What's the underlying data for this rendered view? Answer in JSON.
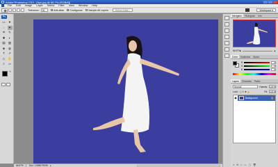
{
  "window": {
    "title": "Adobe Photoshop CS3 - [Ayu.jpg @ 66.7% (RGB/8)]",
    "controls": [
      "–",
      "□",
      "✕"
    ]
  },
  "menu": [
    "File",
    "Edit",
    "Image",
    "Layer",
    "Select",
    "Filter",
    "View",
    "Window",
    "Help"
  ],
  "options": {
    "tolerance_label": "Tolerance:",
    "tolerance_value": "30",
    "anti_alias": "Anti-alias",
    "contiguous": "Contiguous",
    "sample_all": "Sample All Layers",
    "refine": "Refine Edge...",
    "workspace": "Workspace ▾"
  },
  "toolbox": {
    "logo": "Ps",
    "tools": [
      "▭",
      "➤",
      "◌",
      "✦",
      "⌗",
      "✎",
      "✚",
      "◐",
      "▤",
      "▥",
      "◈",
      "◍",
      "T",
      "➚",
      "◇",
      "✋",
      "⌕",
      "▱"
    ]
  },
  "status": {
    "zoom": "66.67%",
    "doc": "Doc: 1.50M/799.9K",
    "arrow": "▸"
  },
  "panels": {
    "navigator_tabs": [
      "Navigator",
      "Histogram",
      "Info"
    ],
    "nav_zoom": "66.67%",
    "color_tabs": [
      "Color",
      "Swatches",
      "Styles"
    ],
    "color_channels": [
      {
        "label": "R",
        "value": "0"
      },
      {
        "label": "G",
        "value": "0"
      },
      {
        "label": "B",
        "value": "0"
      }
    ],
    "layers_tabs": [
      "Layers",
      "Channels",
      "Paths"
    ],
    "blend_mode": "Normal",
    "opacity_label": "Opacity:",
    "opacity": "100%",
    "lock_label": "Lock:",
    "fill_label": "Fill:",
    "fill": "100%",
    "layer_name": "Background",
    "footer_icons": [
      "∞",
      "fx",
      "◐",
      "▭",
      "▢",
      "🗑"
    ]
  },
  "colors": {
    "canvas_bg": "#3b3e9f",
    "selection_highlight": "#3a63b8"
  }
}
